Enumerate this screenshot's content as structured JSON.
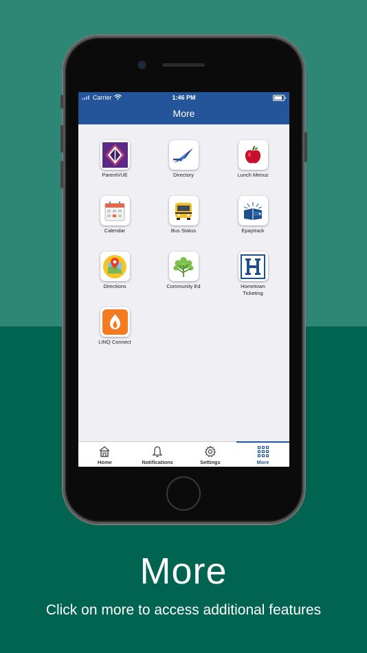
{
  "status_bar": {
    "carrier": "Carrier",
    "time": "1:46 PM"
  },
  "nav": {
    "title": "More"
  },
  "apps": [
    {
      "label": "ParentVUE",
      "icon": "parentvue-icon"
    },
    {
      "label": "Directory",
      "icon": "directory-icon"
    },
    {
      "label": "Lunch Menus",
      "icon": "apple-icon"
    },
    {
      "label": "Calendar",
      "icon": "calendar-icon"
    },
    {
      "label": "Bus Status",
      "icon": "school-bus-icon"
    },
    {
      "label": "Epaytrack",
      "icon": "epaytrack-icon"
    },
    {
      "label": "Directions",
      "icon": "map-pin-icon"
    },
    {
      "label": "Community Ed",
      "icon": "tree-icon"
    },
    {
      "label": "Hometown Ticketing",
      "icon": "hometown-h-icon"
    },
    {
      "label": "LINQ Connect",
      "icon": "linq-connect-icon"
    }
  ],
  "tabs": [
    {
      "label": "Home",
      "icon": "home-icon",
      "active": false
    },
    {
      "label": "Notifications",
      "icon": "bell-icon",
      "active": false
    },
    {
      "label": "Settings",
      "icon": "gear-icon",
      "active": false
    },
    {
      "label": "More",
      "icon": "grid-icon",
      "active": true
    }
  ],
  "caption": {
    "title": "More",
    "subtitle": "Click on more to access additional features"
  },
  "colors": {
    "accent": "#24559a",
    "background_top": "#2e8774",
    "background_bottom": "#006450"
  }
}
